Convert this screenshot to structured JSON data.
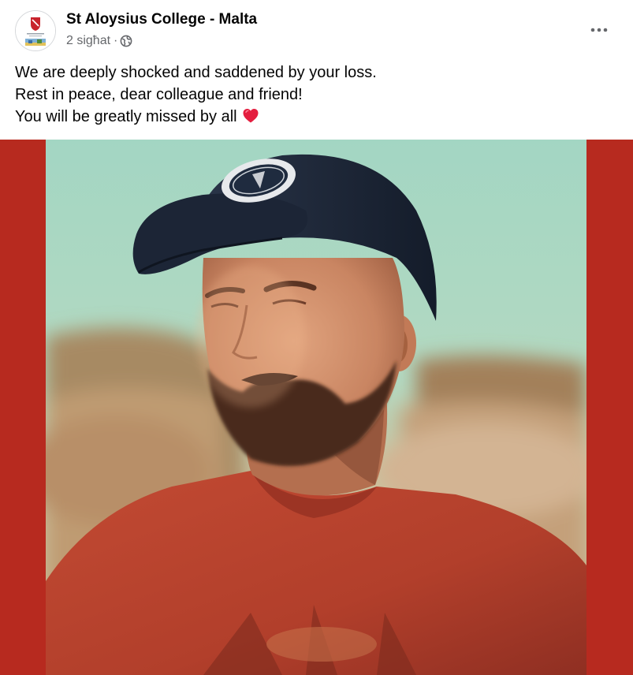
{
  "post": {
    "page_name": "St Aloysius College - Malta",
    "timestamp": "2 sigħat",
    "separator": "·",
    "audience_icon": "globe-icon",
    "more_icon": "more-options-icon",
    "message_lines": [
      "We are deeply shocked and saddened by your loss.",
      "Rest in peace, dear colleague and friend!",
      "You will be greatly missed by all"
    ],
    "message_emoji": "heart-icon"
  },
  "colors": {
    "frame_red": "#b72a1f",
    "sky": "#a9d6c4",
    "shirt": "#b8412d",
    "cap": "#1f2b3f",
    "text_primary": "#050505",
    "text_secondary": "#65676b"
  }
}
